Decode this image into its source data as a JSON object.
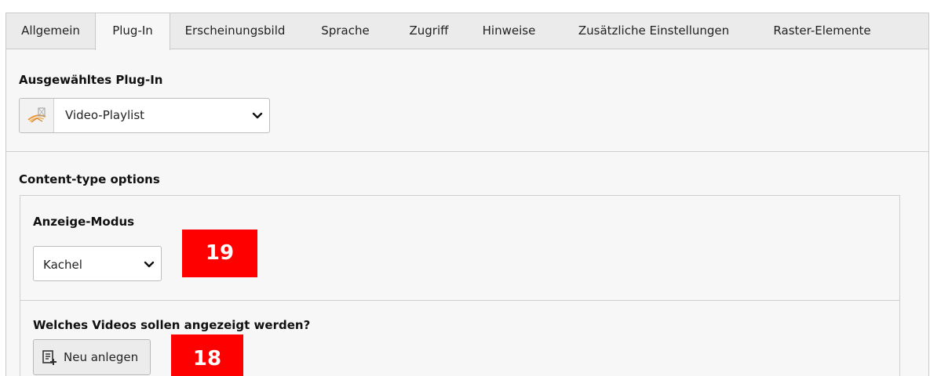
{
  "tabs": [
    {
      "label": "Allgemein",
      "active": false
    },
    {
      "label": "Plug-In",
      "active": true
    },
    {
      "label": "Erscheinungsbild",
      "active": false
    },
    {
      "label": "Sprache",
      "active": false
    },
    {
      "label": "Zugriff",
      "active": false
    },
    {
      "label": "Hinweise",
      "active": false
    },
    {
      "label": "Zusätzliche Einstellungen",
      "active": false
    },
    {
      "label": "Raster-Elemente",
      "active": false
    }
  ],
  "plugin": {
    "heading": "Ausgewähltes Plug-In",
    "selected": "Video-Playlist",
    "icon": "video-playlist-plugin-icon"
  },
  "content_type": {
    "heading": "Content-type options",
    "display_mode": {
      "label": "Anzeige-Modus",
      "selected": "Kachel",
      "badge": "19"
    },
    "videos": {
      "label": "Welches Videos sollen angezeigt werden?",
      "new_button": "Neu anlegen",
      "badge": "18",
      "icon": "add-record-icon"
    }
  },
  "colors": {
    "badge": "#ff0000",
    "tab_bar": "#ebebeb",
    "panel": "#f7f7f7"
  }
}
